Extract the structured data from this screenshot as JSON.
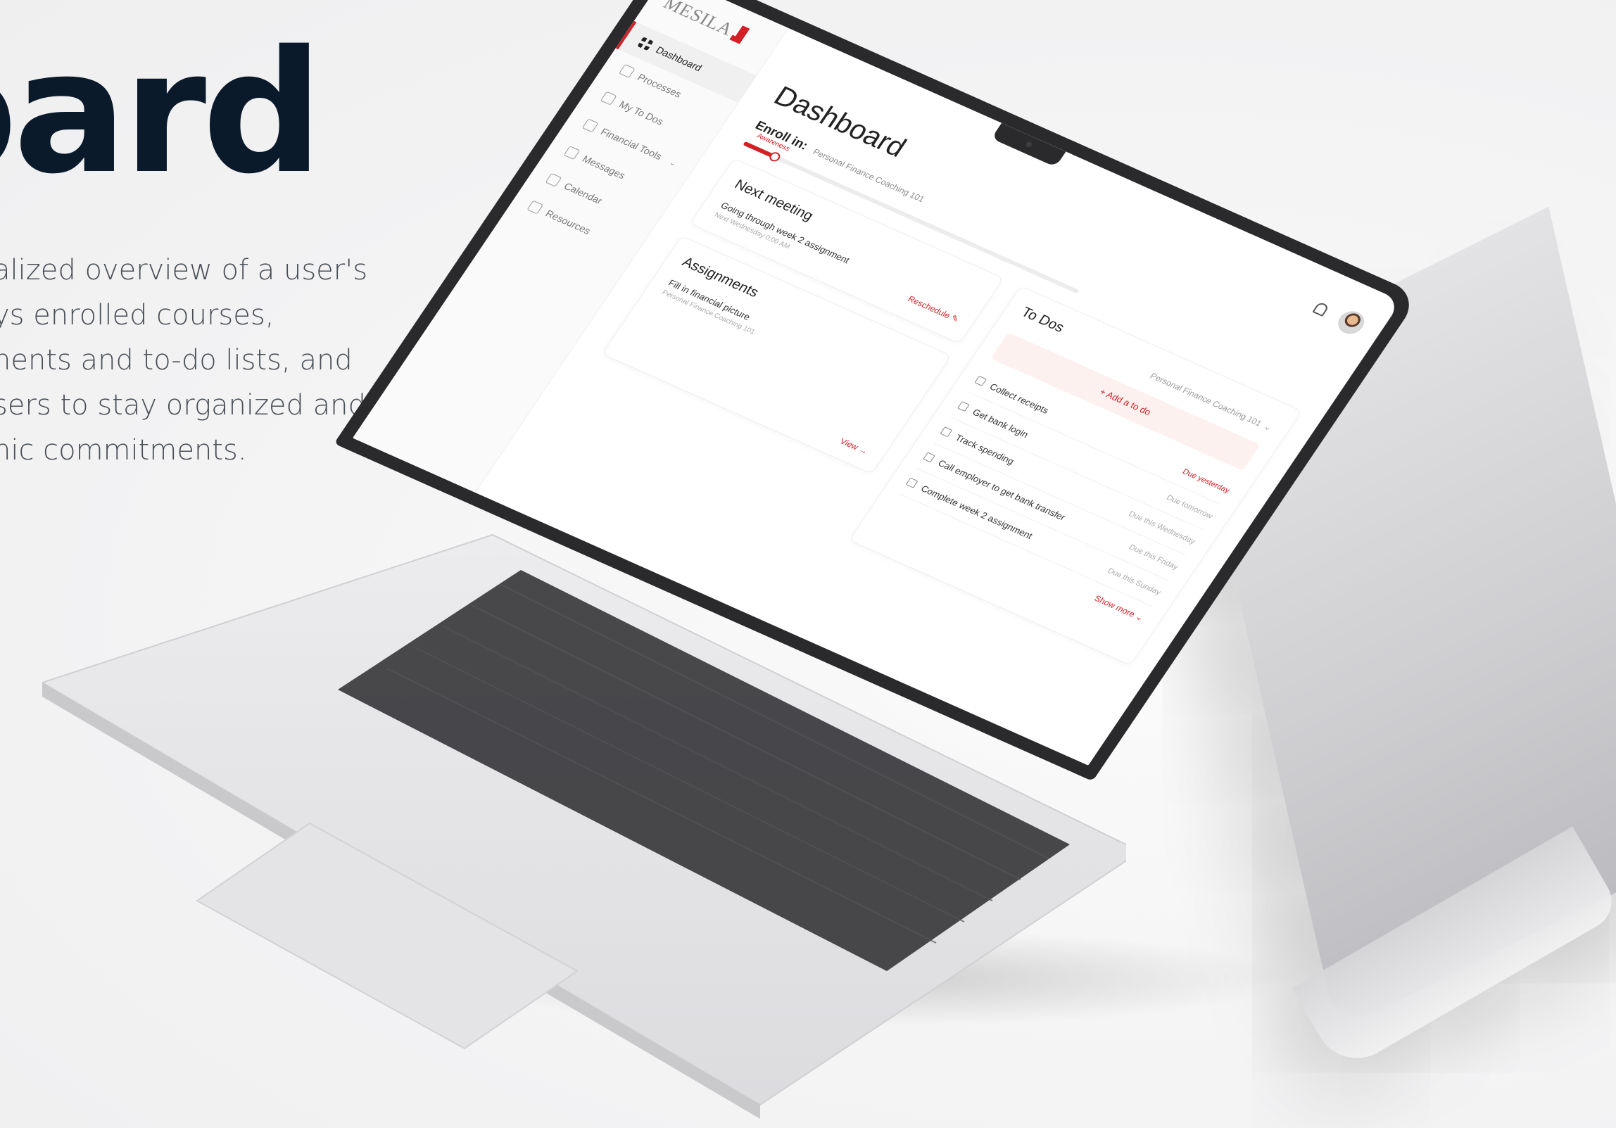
{
  "hero": {
    "title": "oard",
    "description_lines": [
      "alized overview of a user's",
      "ys enrolled courses,",
      "nents and to-do lists, and",
      "sers to stay organized and",
      "nic commitments."
    ]
  },
  "app": {
    "logo_text": "MESILA",
    "sidebar": {
      "items": [
        {
          "label": "Dashboard",
          "icon": "grid-icon",
          "active": true
        },
        {
          "label": "Processes",
          "icon": "document-icon"
        },
        {
          "label": "My To Dos",
          "icon": "checklist-icon"
        },
        {
          "label": "Financial Tools",
          "icon": "calculator-icon",
          "chevron": "⌄"
        },
        {
          "label": "Messages",
          "icon": "message-icon"
        },
        {
          "label": "Calendar",
          "icon": "calendar-icon"
        },
        {
          "label": "Resources",
          "icon": "book-icon"
        }
      ]
    },
    "page_title": "Dashboard",
    "enroll": {
      "label": "Enroll in:",
      "course": "Personal Finance Coaching 101",
      "stage": "Awareness",
      "progress": 0.09
    },
    "next_meeting": {
      "title": "Next meeting",
      "meeting": "Going through week 2 assignment",
      "time": "Next Wednesday 0:00 AM",
      "action": "Reschedule ✎"
    },
    "assignments": {
      "title": "Assignments",
      "item": "Fill in financial picture",
      "course": "Personal Finance Coaching 101",
      "action": "View →"
    },
    "todos": {
      "title": "To Dos",
      "course_select": "Personal Finance Coaching 101",
      "add_label": "+  Add a to do",
      "items": [
        {
          "label": "Collect receipts",
          "due": "Due yesterday",
          "overdue": true
        },
        {
          "label": "Get bank login",
          "due": "Due tomorrow"
        },
        {
          "label": "Track spending",
          "due": "Due this Wednesday"
        },
        {
          "label": "Call employer to get bank transfer",
          "due": "Due this Friday"
        },
        {
          "label": "Complete week 2 assignment",
          "due": "Due this Sunday"
        }
      ],
      "show_more": "Show more ⌄"
    }
  },
  "colors": {
    "accent": "#d32027",
    "hero_title": "#0b1a2b"
  }
}
